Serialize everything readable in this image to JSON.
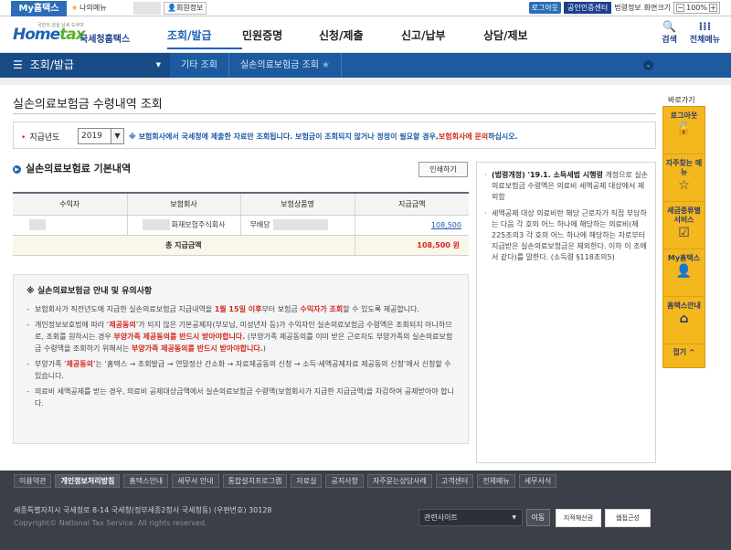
{
  "topbar": {
    "my_hometax": "My홈택스",
    "my_menu": "나의메뉴",
    "user_info": "회원정보",
    "logout": "로그아웃",
    "cert_center": "공인인증센터",
    "legal_info": "법령정보",
    "screen_size_label": "화면크기",
    "zoom_minus": "−",
    "zoom_value": "100%",
    "zoom_plus": "+"
  },
  "header": {
    "logo_tagline": "국민의 성실 납세 도우미",
    "logo_home": "Home",
    "logo_tax": "tax",
    "logo_agency": "국세청홈택스",
    "nav": [
      "조회/발급",
      "민원증명",
      "신청/제출",
      "신고/납부",
      "상담/제보"
    ],
    "search": "검색",
    "all_menu": "전체메뉴"
  },
  "lnb": {
    "menu": "조회/발급",
    "crumbs": [
      "기타 조회",
      "실손의료보험금 조회"
    ]
  },
  "page": {
    "title": "실손의료보험금 수령내역 조회",
    "year_label": "지급년도",
    "year_value": "2019",
    "notice_pre": "※ 보험회사에서 국세청에 제출한 자료만 조회됩니다. 보험금이 조회되지 않거나 정정이 필요할 경우,",
    "notice_red": "보험회사에 문의",
    "notice_post": "하십시오."
  },
  "basic": {
    "title": "실손의료보험료 기본내역",
    "print_button": "인쇄하기",
    "columns": [
      "수익자",
      "보험회사",
      "보험상품명",
      "지급금액"
    ],
    "rows": [
      {
        "company": "화재보험주식회사",
        "product": "무배당",
        "amount": "108,500"
      }
    ],
    "total_label": "총 지급금액",
    "total_amount": "108,500 원"
  },
  "sidebox": {
    "item1_bold": "(법령개정) '19.1. 소득세법 시행령",
    "item1_rest": "개정으로 실손의료보험금 수령액은 의료비 세액공제 대상에서 제외함",
    "item2": "세액공제 대상 의료비란 해당 근로자가 직접 부담하는 다음 각 호의 어느 하나에 해당하는 의료비(제225조의3 각 호의 어느 하나에 해당하는 자로부터 지급받은 실손의료보험금은 제외한다. 이하 이 조에서 같다)를 말한다. (소득령 §118조의5)"
  },
  "info": {
    "head": "※ 실손의료보험금 안내 및 유의사항",
    "li1_a": "보험회사가 직전년도에 지급한 실손의료보험금 지급내역을 ",
    "li1_b": "1월 15일 이후",
    "li1_c": "부터 보험금 ",
    "li1_d": "수익자가 조회",
    "li1_e": "할 수 있도록 제공합니다.",
    "li2_a": "개인정보보호법에 따라 ‘",
    "li2_b": "제공동의",
    "li2_c": "’가 되지 않은 기본공제자(부모님, 미성년자 등)가 수익자인 실손의료보험금 수령액은 조회되지 아니하므로, 조회를 원하시는 경우 ",
    "li2_d": "부양가족 제공동의를 반드시 받아야합니다.",
    "li2_e": " (부양가족 제공동의를 이미 받은 근로자도 부양가족의 실손의료보험금 수령액을 조회하기 위해서는 ",
    "li2_f": "부양가족 제공동의를 반드시 받아야합니다.",
    "li2_g": ")",
    "li3_a": "부양가족 ‘",
    "li3_b": "제공동의",
    "li3_c": "’는 ‘홈택스 → 조회발급 → 연말정산 간소화 → 자료제공동의 신청 → 소득·세액공제자료 제공동의 신청’에서 신청할 수 있습니다.",
    "li4": "의료비 세액공제를 받는 경우, 의료비 공제대상금액에서 실손의료보험금 수령액(보험회사가 지급한 지급금액)을 차감하여 공제받아야 합니다."
  },
  "rightbar": {
    "label": "바로가기",
    "items": [
      "로그아웃",
      "자주찾는 메뉴",
      "세금종류별 서비스",
      "My홈택스",
      "홈택스안내"
    ],
    "close": "접기 ^"
  },
  "footer": {
    "nav": [
      "이용약관",
      "개인정보처리방침",
      "홈택스안내",
      "세무서 안내",
      "통합설치프로그램",
      "자료실",
      "공지사항",
      "자주묻는상담사례",
      "고객센터",
      "전체메뉴",
      "세무서식"
    ],
    "address": "세종특별자치시 국세청로 8-14 국세청(정부세종2청사 국세청동) (우편번호) 30128",
    "copyright": "Copyright© National Tax Service. All rights reserved.",
    "related_site": "관련사이트",
    "go": "이동",
    "badge1": "지적재산권",
    "badge2": "웹접근성"
  }
}
